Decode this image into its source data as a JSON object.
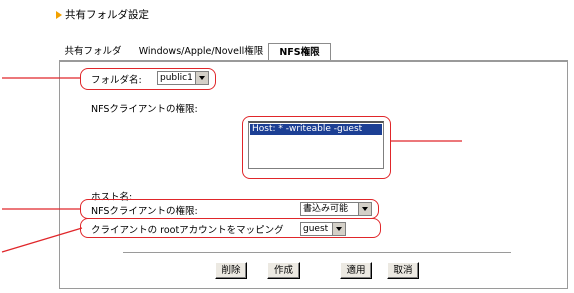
{
  "header": {
    "title": "共有フォルダ設定"
  },
  "tabs": [
    {
      "label": "共有フォルダ"
    },
    {
      "label": "Windows/Apple/Novell権限"
    },
    {
      "label": "NFS権限"
    }
  ],
  "form": {
    "folder_label": "フォルダ名:",
    "folder_value": "public1",
    "clients_label": "NFSクライアントの権限:",
    "clients_list": [
      "Host: * -writeable -guest"
    ],
    "host_label": "ホスト名:",
    "permission_label": "NFSクライアントの権限:",
    "permission_value": "書込み可能",
    "root_label": "クライアントの rootアカウントをマッピング",
    "root_value": "guest"
  },
  "buttons": {
    "delete": "削除",
    "create": "作成",
    "apply": "適用",
    "cancel": "取消"
  },
  "colors": {
    "annotation": "#e0262a",
    "accent_arrow": "#f2a100",
    "selection": "#1c3f94"
  }
}
